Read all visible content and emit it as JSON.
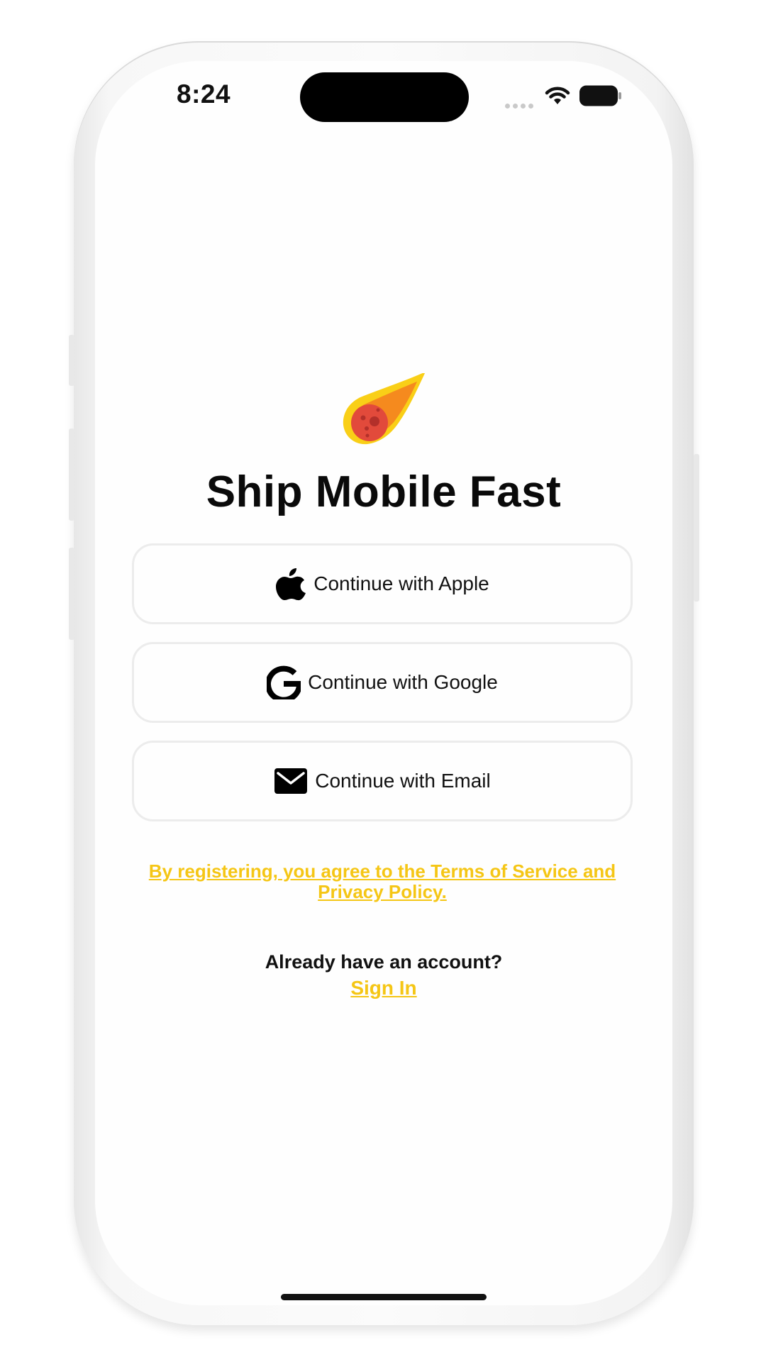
{
  "status_bar": {
    "time": "8:24",
    "icons": [
      "cellular-dots-icon",
      "wifi-icon",
      "battery-icon"
    ]
  },
  "app": {
    "logo_icon": "comet-icon",
    "title": "Ship Mobile Fast"
  },
  "auth_buttons": [
    {
      "label": "Continue with Apple",
      "icon": "apple-icon"
    },
    {
      "label": "Continue with Google",
      "icon": "google-icon"
    },
    {
      "label": "Continue with Email",
      "icon": "envelope-icon"
    }
  ],
  "terms": {
    "text": "By registering, you agree to the Terms of Service and Privacy Policy."
  },
  "signin": {
    "prompt": "Already have an account?",
    "link": "Sign In"
  },
  "colors": {
    "accent": "#f5c615",
    "text": "#111111",
    "button_border": "#ececec",
    "background": "#fefefe"
  }
}
